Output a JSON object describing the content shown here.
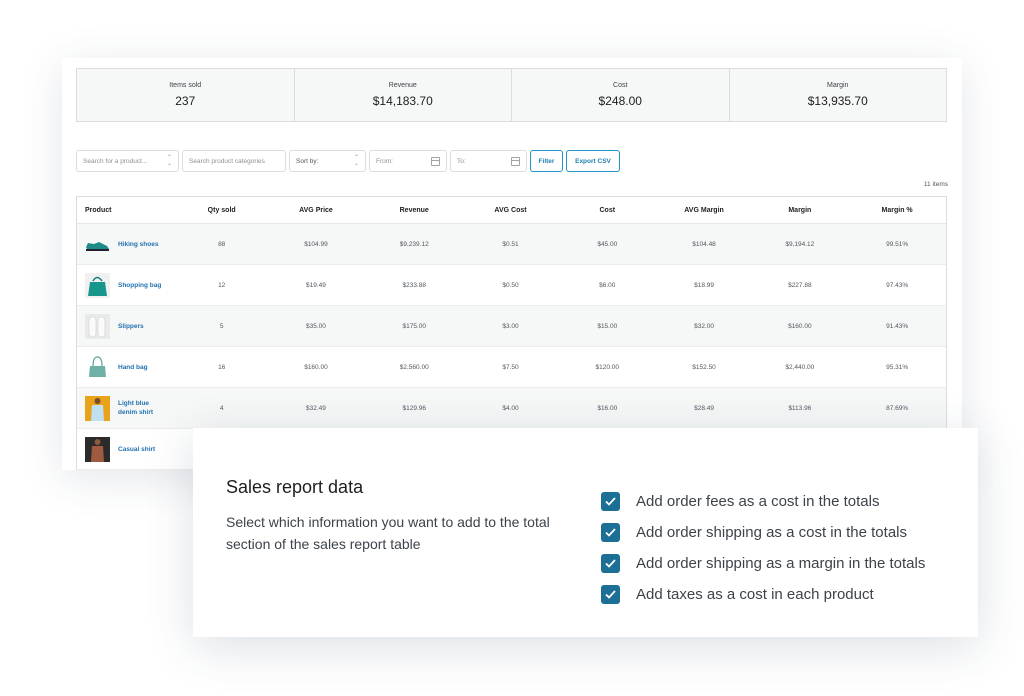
{
  "summary": [
    {
      "label": "Items sold",
      "value": "237"
    },
    {
      "label": "Revenue",
      "value": "$14,183.70"
    },
    {
      "label": "Cost",
      "value": "$248.00"
    },
    {
      "label": "Margin",
      "value": "$13,935.70"
    }
  ],
  "toolbar": {
    "search_product_placeholder": "Search for a product...",
    "search_categories_placeholder": "Search product categories",
    "sort_label": "Sort by:",
    "from_label": "From:",
    "to_label": "To:",
    "filter_label": "Filter",
    "export_label": "Export CSV"
  },
  "item_count": "11 items",
  "table": {
    "columns": [
      "Product",
      "Qty sold",
      "AVG Price",
      "Revenue",
      "AVG Cost",
      "Cost",
      "AVG Margin",
      "Margin",
      "Margin %"
    ],
    "rows": [
      {
        "product": "Hiking shoes",
        "qty": "88",
        "avg_price": "$104.99",
        "revenue": "$9,239.12",
        "avg_cost": "$0.51",
        "cost": "$45.00",
        "avg_margin": "$104.48",
        "margin": "$9,194.12",
        "margin_pct": "99.51%"
      },
      {
        "product": "Shopping bag",
        "qty": "12",
        "avg_price": "$19.49",
        "revenue": "$233.88",
        "avg_cost": "$0.50",
        "cost": "$6.00",
        "avg_margin": "$18.99",
        "margin": "$227.88",
        "margin_pct": "97.43%"
      },
      {
        "product": "Slippers",
        "qty": "5",
        "avg_price": "$35.00",
        "revenue": "$175.00",
        "avg_cost": "$3.00",
        "cost": "$15.00",
        "avg_margin": "$32.00",
        "margin": "$160.00",
        "margin_pct": "91.43%"
      },
      {
        "product": "Hand bag",
        "qty": "16",
        "avg_price": "$160.00",
        "revenue": "$2,560.00",
        "avg_cost": "$7.50",
        "cost": "$120.00",
        "avg_margin": "$152.50",
        "margin": "$2,440.00",
        "margin_pct": "95.31%"
      },
      {
        "product": "Light blue denim shirt",
        "qty": "4",
        "avg_price": "$32.49",
        "revenue": "$129.96",
        "avg_cost": "$4.00",
        "cost": "$16.00",
        "avg_margin": "$28.49",
        "margin": "$113.96",
        "margin_pct": "87.69%"
      },
      {
        "product": "Casual shirt"
      }
    ]
  },
  "settings": {
    "title": "Sales report data",
    "description": "Select which information you want to add to the total section of the sales report table",
    "options": [
      {
        "label": "Add order fees as a cost in the totals",
        "checked": true
      },
      {
        "label": "Add order shipping as a cost in the totals",
        "checked": true
      },
      {
        "label": "Add order shipping as a margin in the totals",
        "checked": true
      },
      {
        "label": "Add taxes as a cost in each product",
        "checked": true
      }
    ]
  },
  "colors": {
    "accent": "#2271b1",
    "checkbox": "#1c6f95",
    "button_border": "#2196c9"
  }
}
